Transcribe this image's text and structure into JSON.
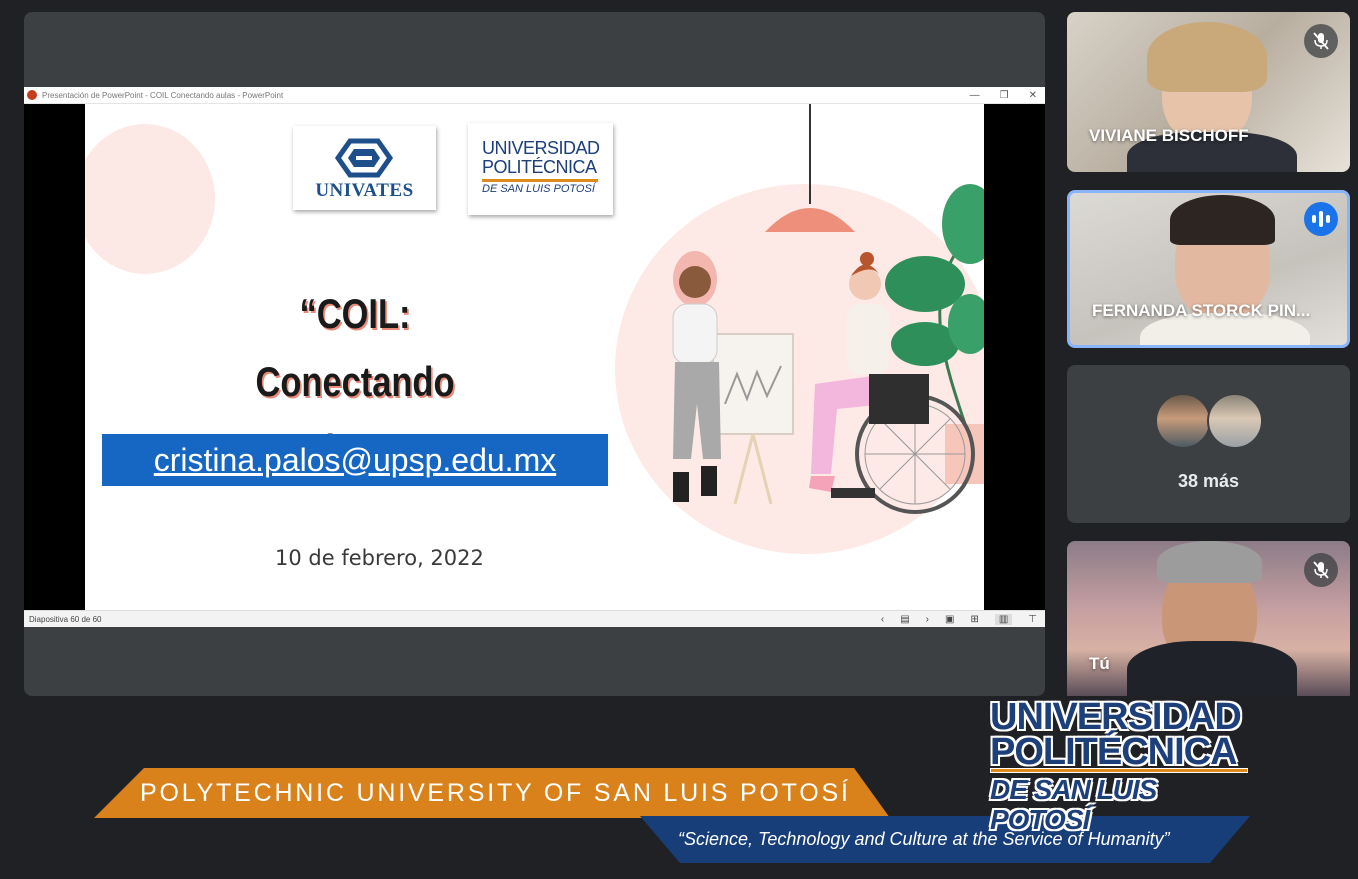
{
  "ppt": {
    "window_title": "Presentación de PowerPoint  -  COIL Conectando aulas - PowerPoint",
    "status": "Diapositiva 60 de 60"
  },
  "slide": {
    "logo_univates": "UNIVATES",
    "logo_upslp": {
      "line1": "UNIVERSIDAD",
      "line2": "POLITÉCNICA",
      "line3": "DE SAN LUIS POTOSÍ"
    },
    "title_line1": "“COIL: Conectando",
    "title_line2": "aulas…”",
    "email": "cristina.palos@upsp.edu.mx",
    "date": "10 de febrero, 2022"
  },
  "participants": [
    {
      "name": "VIVIANE BISCHOFF",
      "muted": true
    },
    {
      "name": "FERNANDA STORCK PIN...",
      "speaking": true
    },
    {
      "more": "38 más"
    },
    {
      "name": "Tú",
      "muted": true
    }
  ],
  "banner": {
    "university_en": "POLYTECHNIC UNIVERSITY OF SAN LUIS POTOSÍ",
    "motto": "“Science, Technology and Culture at the Service of Humanity”",
    "logo": {
      "line1": "UNIVERSIDAD",
      "line2": "POLITÉCNICA",
      "line3": "DE SAN LUIS POTOSÍ"
    }
  },
  "colors": {
    "accent_orange": "#d9821b",
    "accent_blue": "#173e78",
    "speaking_blue": "#1a73e8",
    "email_box": "#1667c4"
  }
}
